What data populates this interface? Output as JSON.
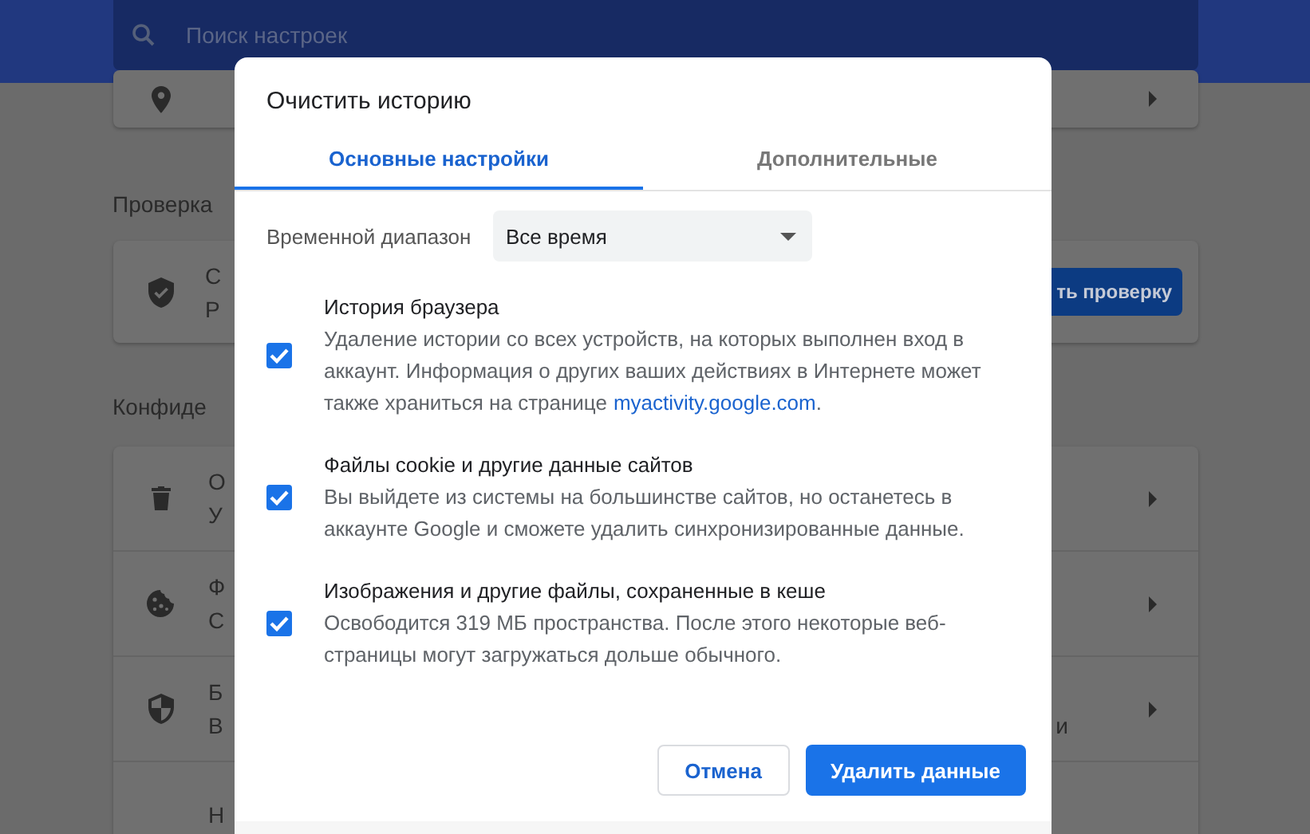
{
  "search": {
    "placeholder": "Поиск настроек"
  },
  "safety_section": {
    "title": "Проверка",
    "card": {
      "title": "С",
      "subtitle": "Р",
      "button": "ть проверку"
    }
  },
  "privacy_section": {
    "title": "Конфиде",
    "rows": [
      {
        "kind": "trash",
        "title": "О",
        "subtitle": "У"
      },
      {
        "kind": "cookie",
        "title": "Ф",
        "subtitle": "С"
      },
      {
        "kind": "shield",
        "title": "Б",
        "subtitle": "В",
        "right_text": "и"
      },
      {
        "kind": "plain",
        "title": "Н"
      }
    ]
  },
  "dialog": {
    "title": "Очистить историю",
    "tabs": [
      {
        "label": "Основные настройки",
        "selected": true
      },
      {
        "label": "Дополнительные",
        "selected": false
      }
    ],
    "time_range": {
      "label": "Временной диапазон",
      "value": "Все время"
    },
    "options": [
      {
        "title": "История браузера",
        "description": "Удаление истории со всех устройств, на которых выполнен вход в аккаунт. Информация о других ваших действиях в Интернете может также храниться на странице",
        "link": "myactivity.google.com",
        "after_link": ".",
        "checked": true
      },
      {
        "title": "Файлы cookie и другие данные сайтов",
        "description": "Вы выйдете из системы на большинстве сайтов, но останетесь в аккаунте Google и сможете удалить синхронизированные данные.",
        "checked": true
      },
      {
        "title": "Изображения и другие файлы, сохраненные в кеше",
        "description": "Освободится 319 МБ пространства. После этого некоторые веб-страницы могут загружаться дольше обычного.",
        "checked": true
      }
    ],
    "buttons": [
      {
        "label": "Отмена",
        "kind": "secondary"
      },
      {
        "label": "Удалить данные",
        "kind": "primary"
      }
    ]
  }
}
